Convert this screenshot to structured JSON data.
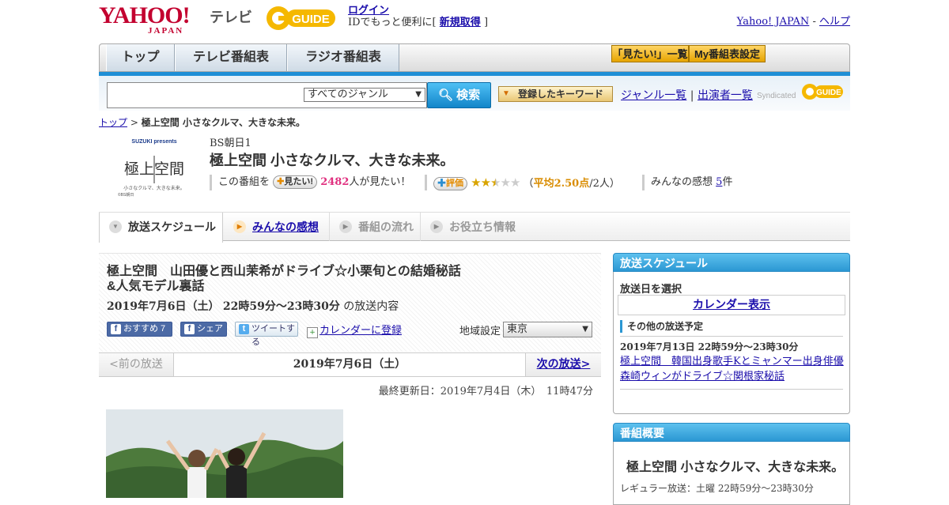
{
  "header": {
    "yahoo_logo": "YAHOO!",
    "yahoo_logo_sub": "JAPAN",
    "tv_label": "テレビ",
    "gguide_logo": "GUIDE",
    "login": "ログイン",
    "login_note": "IDでもっと便利に[",
    "signup": "新規取得",
    "login_note_end": "]",
    "yahoo_japan_link": "Yahoo! JAPAN",
    "link_separator": "-",
    "help_link": "ヘルプ"
  },
  "nav": {
    "tabs": [
      "トップ",
      "テレビ番組表",
      "ラジオ番組表"
    ],
    "mitai_list": "「見たい!」一覧",
    "my_schedule": "My番組表設定"
  },
  "search": {
    "genre_selected": "すべてのジャンル",
    "search_button": "検索",
    "keyword_button": "登録したキーワード",
    "genre_list": "ジャンル一覧",
    "separator": "|",
    "performer_list": "出演者一覧",
    "syndicated": "Syndicated",
    "syndicated_logo": "GUIDE"
  },
  "breadcrumb": {
    "top": "トップ",
    "sep": ">",
    "current": "極上空間 小さなクルマ、大きな未来。"
  },
  "program": {
    "thumb_brand": "SUZUKI presents",
    "thumb_title": "極上空間",
    "thumb_tagline": "小さなクルマ、大きな未来。",
    "thumb_copyright": "©BS朝日",
    "channel": "BS朝日1",
    "title": "極上空間 小さなクルマ、大きな未来。",
    "prefix": "この番組を",
    "mitai_button": "見たい!",
    "mitai_count": "2482",
    "mitai_suffix": "人が見たい！",
    "rate_button": "評価",
    "rating_stars": 2.5,
    "rating_open": "（",
    "rating_avg": "平均2.50点",
    "rating_count": "/2人）",
    "impressions_label": "みんなの感想",
    "impressions_count": "5",
    "impressions_unit": "件"
  },
  "tabs": {
    "schedule": "放送スケジュール",
    "impressions": "みんなの感想",
    "flow": "番組の流れ",
    "info": "お役立ち情報"
  },
  "episode": {
    "title_line1": "極上空間　山田優と西山茉希がドライブ☆小栗旬との結婚秘話",
    "title_line2": "&人気モデル裏話",
    "date": "2019年7月6日（土）",
    "time": "22時59分～23時30分",
    "date_suffix": "の放送内容",
    "fb_recommend": "おすすめ 7",
    "fb_share": "シェア",
    "tweet": "ツイートする",
    "calendar_register": "カレンダーに登録",
    "region_label": "地域設定",
    "region_selected": "東京"
  },
  "pager": {
    "prev": "<前の放送",
    "current": "2019年7月6日（土）",
    "next": "次の放送>"
  },
  "updated": "最終更新日：2019年7月4日（木）　11時47分",
  "sidebar": {
    "schedule_head": "放送スケジュール",
    "select_date": "放送日を選択",
    "calendar_show": "カレンダー表示",
    "other_schedule": "その他の放送予定",
    "other_date": "2019年7月13日  22時59分～23時30分",
    "other_title": "極上空間　韓国出身歌手Kとミャンマー出身俳優森崎ウィンがドライブ☆関根家秘話",
    "overview_head": "番組概要",
    "overview_title": "極上空間 小さなクルマ、大きな未来。",
    "overview_regular": "レギュラー放送：土曜 22時59分～23時30分"
  },
  "colors": {
    "accent_blue": "#1e8fd6",
    "yahoo_red": "#c3002f",
    "gguide_yellow": "#f5b800",
    "mitai_pink": "#e0307f"
  }
}
